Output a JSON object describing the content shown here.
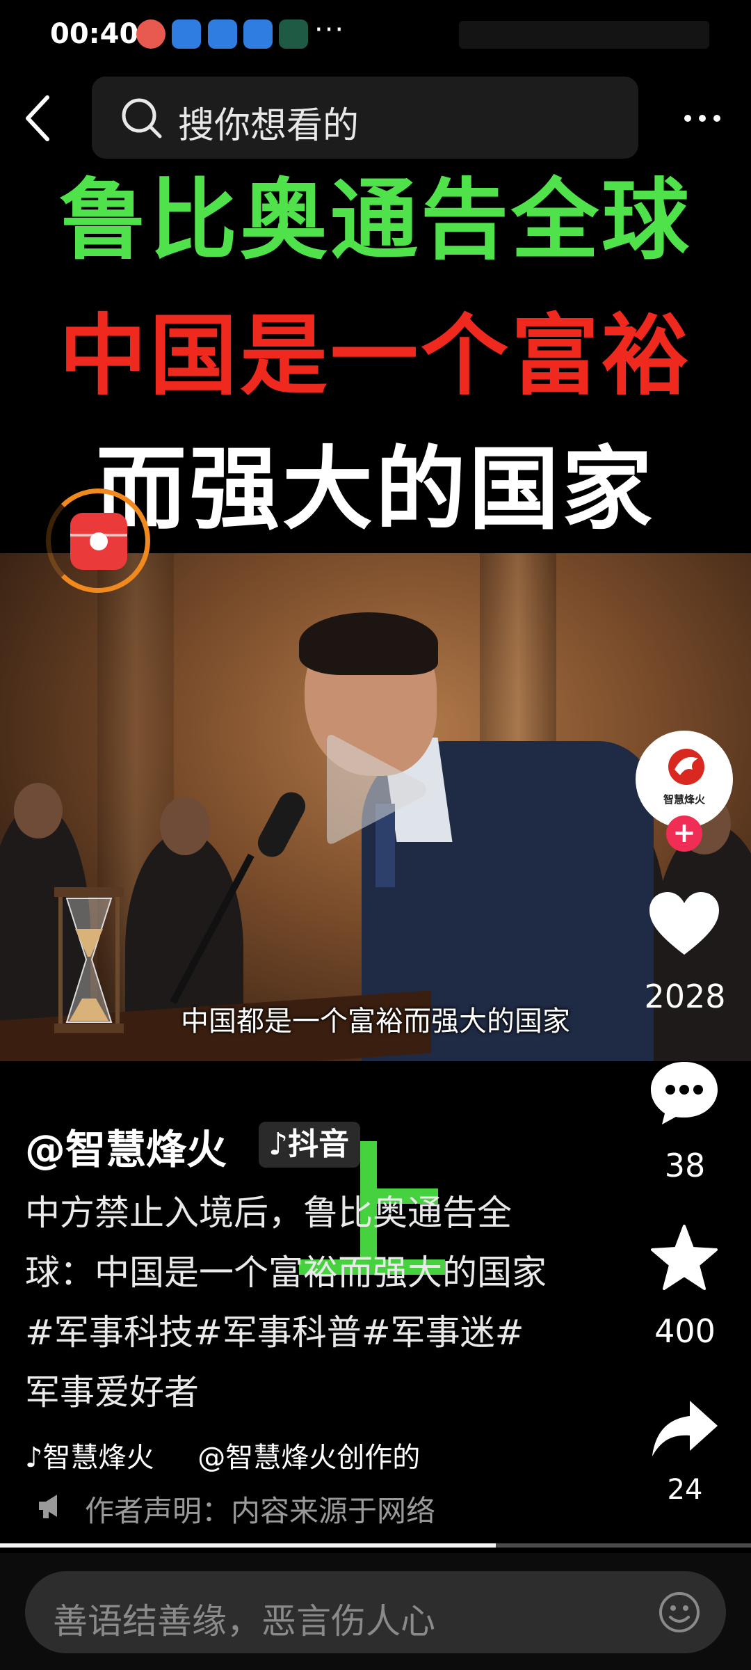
{
  "status_bar": {
    "time": "00:40",
    "more": "···"
  },
  "search": {
    "placeholder": "搜你想看的"
  },
  "headline": {
    "line1": "鲁比奥通告全球",
    "line2": "中国是一个富裕",
    "line3": "而强大的国家"
  },
  "video": {
    "subtitle": "中国都是一个富裕而强大的国家",
    "progress_fraction": 0.66
  },
  "avatar": {
    "mark_text": "智慧烽火",
    "follow_symbol": "+"
  },
  "actions": {
    "likes": "2028",
    "comments": "38",
    "favorites": "400",
    "shares": "24"
  },
  "post": {
    "author": "@智慧烽火",
    "platform_tag": "抖音",
    "caption": "中方禁止入境后，鲁比奥通告全球：中国是一个富裕而强大的国家 #军事科技#军事科普#军事迷#军事爱好者",
    "music_left": "♪智慧烽火",
    "music_right": "@智慧烽火创作的",
    "statement": "作者声明：内容来源于网络"
  },
  "comment_bar": {
    "placeholder": "善语结善缘，恶言伤人心"
  },
  "colors": {
    "headline_green": "#4fe24b",
    "headline_red": "#f0291e",
    "follow_pink": "#ef2d55",
    "redpacket_orange": "#f08a1e"
  },
  "icons": [
    "back-arrow-icon",
    "search-icon",
    "more-icon",
    "red-packet-icon",
    "play-icon",
    "heart-icon",
    "comment-icon",
    "star-icon",
    "share-icon",
    "megaphone-icon",
    "emoji-icon"
  ]
}
